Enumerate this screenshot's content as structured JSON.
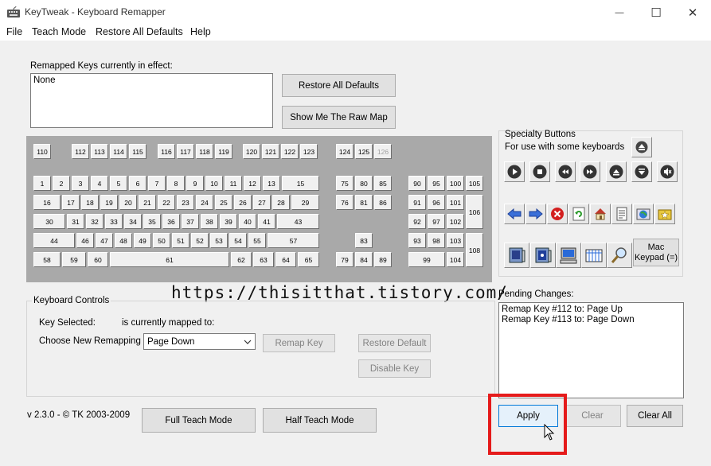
{
  "window": {
    "title": "KeyTweak -  Keyboard Remapper",
    "minimize_glyph": "—",
    "maximize_glyph": "☐",
    "close_glyph": "✕"
  },
  "menu": [
    "File",
    "Teach Mode",
    "Restore All Defaults",
    "Help"
  ],
  "remapped": {
    "label": "Remapped Keys currently in effect:",
    "value": "None",
    "restore_all_button": "Restore All Defaults",
    "raw_map_button": "Show Me The Raw Map"
  },
  "keyboard": {
    "keys": [
      "110",
      "112",
      "113",
      "114",
      "115",
      "116",
      "117",
      "118",
      "119",
      "120",
      "121",
      "122",
      "123",
      "124",
      "125",
      "126",
      "1",
      "2",
      "3",
      "4",
      "5",
      "6",
      "7",
      "8",
      "9",
      "10",
      "11",
      "12",
      "13",
      "15",
      "16",
      "17",
      "18",
      "19",
      "20",
      "21",
      "22",
      "23",
      "24",
      "25",
      "26",
      "27",
      "28",
      "29",
      "30",
      "31",
      "32",
      "33",
      "34",
      "35",
      "36",
      "37",
      "38",
      "39",
      "40",
      "41",
      "43",
      "44",
      "46",
      "47",
      "48",
      "49",
      "50",
      "51",
      "52",
      "53",
      "54",
      "55",
      "57",
      "58",
      "59",
      "60",
      "61",
      "62",
      "63",
      "64",
      "65",
      "75",
      "80",
      "85",
      "76",
      "81",
      "86",
      "83",
      "79",
      "84",
      "89",
      "90",
      "95",
      "100",
      "105",
      "91",
      "96",
      "101",
      "106",
      "92",
      "97",
      "102",
      "93",
      "98",
      "103",
      "108",
      "99",
      "104"
    ]
  },
  "specialty": {
    "title": "Specialty Buttons",
    "subtitle": "For use with some keyboards",
    "mac_keypad": "Mac\nKeypad (=)",
    "icons": [
      "eject-icon",
      "play-icon",
      "stop-icon",
      "rewind-icon",
      "fast-forward-icon",
      "volume-up-icon",
      "volume-down-icon",
      "mute-icon",
      "back-arrow-icon",
      "forward-arrow-icon",
      "stop-red-icon",
      "refresh-icon",
      "home-icon",
      "document-icon",
      "web-globe-icon",
      "favorites-icon",
      "media-player-icon",
      "app-window-icon",
      "my-computer-icon",
      "calculator-icon",
      "search-magnifier-icon"
    ]
  },
  "watermark": "https://thisitthat.tistory.com/",
  "controls": {
    "legend": "Keyboard Controls",
    "key_selected_label": "Key Selected:",
    "mapped_to_label": "is currently mapped to:",
    "choose_label": "Choose New Remapping",
    "choose_value": "Page Down",
    "remap_button": "Remap Key",
    "restore_default_button": "Restore Default",
    "disable_button": "Disable Key"
  },
  "pending": {
    "label": "Pending Changes:",
    "items": [
      "Remap Key #112 to: Page Up",
      "Remap Key #113 to: Page Down"
    ],
    "apply_button": "Apply",
    "clear_button": "Clear",
    "clear_all_button": "Clear All"
  },
  "footer": {
    "version": "v 2.3.0 - © TK 2003-2009",
    "full_teach_button": "Full Teach Mode",
    "half_teach_button": "Half Teach Mode"
  },
  "colors": {
    "highlight": "#e51b1b",
    "keyboard_bg": "#a9a9a9",
    "accent": "#0078d7"
  }
}
